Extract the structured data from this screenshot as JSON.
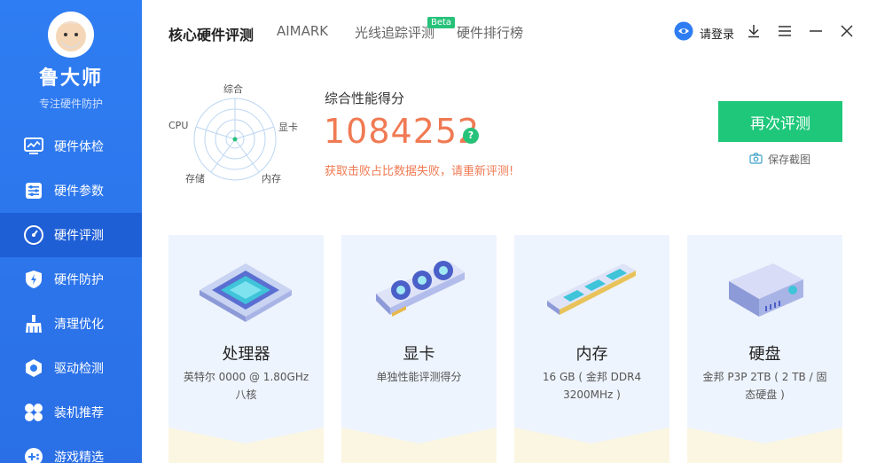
{
  "app": {
    "name": "鲁大师",
    "slogan": "专注硬件防护"
  },
  "sidebar": {
    "items": [
      {
        "label": "硬件体检",
        "icon": "monitor-icon"
      },
      {
        "label": "硬件参数",
        "icon": "sliders-icon"
      },
      {
        "label": "硬件评测",
        "icon": "speedometer-icon"
      },
      {
        "label": "硬件防护",
        "icon": "shield-bolt-icon"
      },
      {
        "label": "清理优化",
        "icon": "broom-icon"
      },
      {
        "label": "驱动检测",
        "icon": "gear-hex-icon"
      },
      {
        "label": "装机推荐",
        "icon": "clover-icon"
      },
      {
        "label": "游戏精选",
        "icon": "game-plus-icon"
      }
    ],
    "active_index": 2
  },
  "header": {
    "tabs": [
      {
        "label": "核心硬件评测"
      },
      {
        "label": "AIMARK"
      },
      {
        "label": "光线追踪评测"
      },
      {
        "label": "硬件排行榜"
      }
    ],
    "beta_badge": "Beta",
    "login_label": "请登录"
  },
  "radar": {
    "labels": {
      "top": "综合",
      "right": "显卡",
      "bottom_right": "内存",
      "bottom_left": "存储",
      "left": "CPU"
    }
  },
  "score": {
    "title": "综合性能得分",
    "value": "1084252",
    "help": "?",
    "error": "获取击败占比数据失败，请重新评测!"
  },
  "actions": {
    "retest_label": "再次评测",
    "save_label": "保存截图"
  },
  "cards": [
    {
      "name": "处理器",
      "desc": "英特尔 0000 @ 1.80GHz 八核",
      "icon": "cpu-chip-icon"
    },
    {
      "name": "显卡",
      "desc": "单独性能评测得分",
      "icon": "graphics-card-icon"
    },
    {
      "name": "内存",
      "desc": "16 GB ( 金邦 DDR4 3200MHz )",
      "icon": "memory-stick-icon"
    },
    {
      "name": "硬盘",
      "desc": "金邦 P3P 2TB ( 2 TB / 固态硬盘 )",
      "icon": "hard-disk-icon"
    }
  ],
  "colors": {
    "sidebar": "#2f7df2",
    "sidebar_active": "#1f5fd6",
    "accent_green": "#1fc77a",
    "score": "#f07a53",
    "card_bg": "#eef4fd"
  }
}
